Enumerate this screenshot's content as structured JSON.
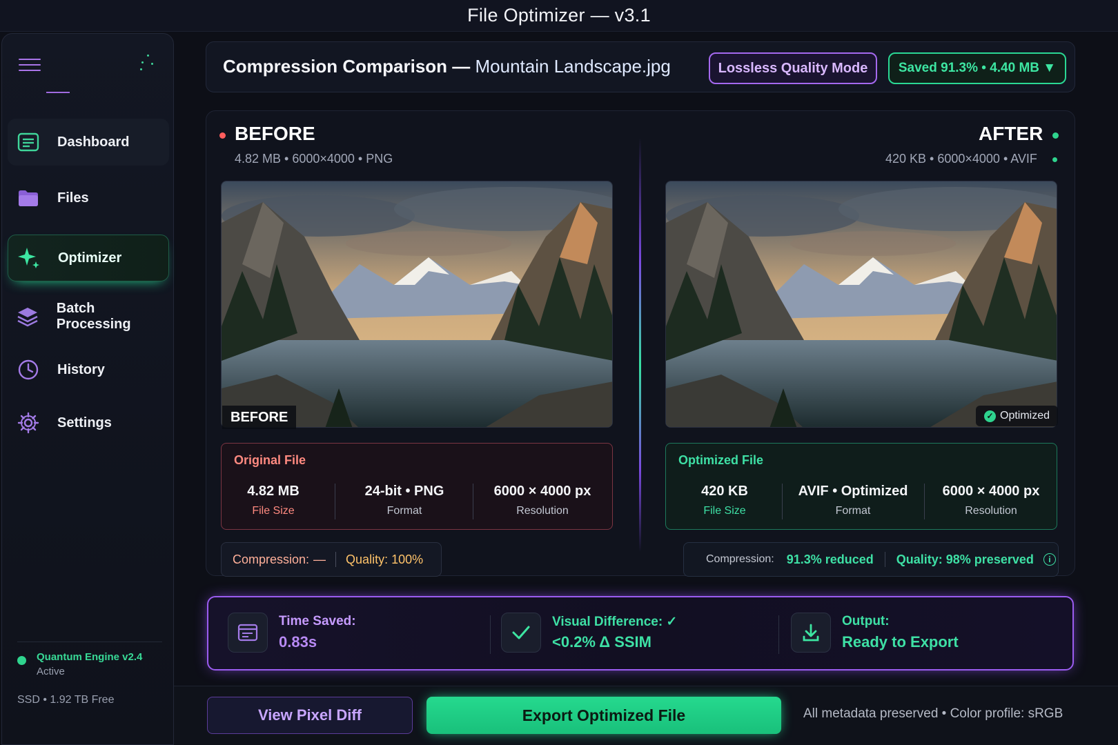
{
  "window": {
    "title": "File Optimizer — v3.1"
  },
  "sidebar": {
    "items": [
      {
        "label": "Dashboard",
        "icon": "dashboard-icon"
      },
      {
        "label": "Files",
        "icon": "folder-icon"
      },
      {
        "label": "Optimizer",
        "icon": "sparkle-icon",
        "active": true
      },
      {
        "label": "Batch Processing",
        "icon": "layers-icon"
      },
      {
        "label": "History",
        "icon": "clock-icon"
      },
      {
        "label": "Settings",
        "icon": "gear-icon"
      }
    ],
    "engine": {
      "name": "Quantum Engine v2.4",
      "status": "Active",
      "status_color": "#2fd48e"
    },
    "storage": "SSD • 1.92 TB Free"
  },
  "header": {
    "title_prefix": "Compression Comparison —",
    "file_name": "Mountain Landscape.jpg",
    "mode_label": "Lossless Quality Mode",
    "saved_label": "Saved 91.3% • 4.40 MB ▼"
  },
  "before": {
    "heading": "BEFORE",
    "meta": "4.82 MB • 6000×4000 • PNG",
    "image_tag": "BEFORE",
    "card_title": "Original File",
    "stats": [
      {
        "value": "4.82 MB",
        "label": "File Size"
      },
      {
        "value": "24-bit • PNG",
        "label": "Format"
      },
      {
        "value": "6000 × 4000 px",
        "label": "Resolution"
      }
    ],
    "compression_label": "Compression:",
    "compression_value": "—",
    "quality_label": "Quality: 100%"
  },
  "after": {
    "heading": "AFTER",
    "meta": "420 KB • 6000×4000 • AVIF",
    "image_tag": "Optimized",
    "card_title": "Optimized File",
    "stats": [
      {
        "value": "420 KB",
        "label": "File Size"
      },
      {
        "value": "AVIF • Optimized",
        "label": "Format"
      },
      {
        "value": "6000 × 4000 px",
        "label": "Resolution"
      }
    ],
    "compression_label": "Compression:",
    "compression_value": "91.3% reduced",
    "quality_label": "Quality: 98% preserved"
  },
  "summary": {
    "time": {
      "label": "Time Saved:",
      "value": "0.83s"
    },
    "visual": {
      "label": "Visual Difference: ✓",
      "value": "<0.2% Δ SSIM"
    },
    "output": {
      "label": "Output:",
      "value": "Ready to Export"
    }
  },
  "footer": {
    "view_diff_label": "View Pixel Diff",
    "export_label": "Export Optimized File",
    "info": "All metadata preserved • Color profile: sRGB"
  },
  "colors": {
    "accent_purple": "#a569ef",
    "accent_green": "#2ad894",
    "warning_red": "#ff8a80",
    "background": "#0d0f17"
  }
}
